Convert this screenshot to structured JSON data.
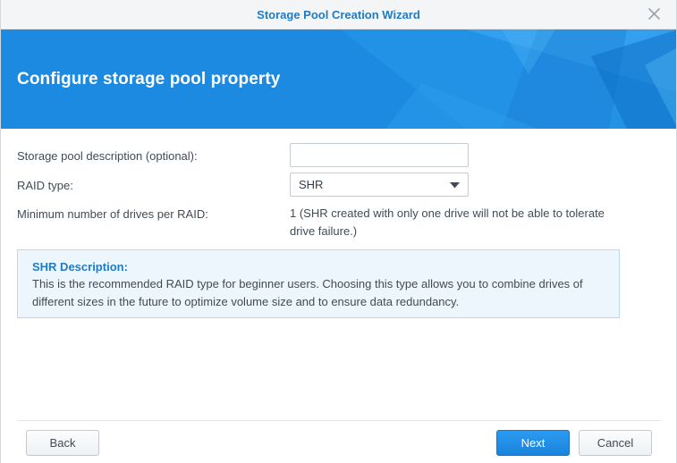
{
  "window": {
    "title": "Storage Pool Creation Wizard"
  },
  "banner": {
    "heading": "Configure storage pool property"
  },
  "form": {
    "description_label": "Storage pool description (optional):",
    "description_value": "",
    "raid_label": "RAID type:",
    "raid_value": "SHR",
    "min_drives_label": "Minimum number of drives per RAID:",
    "min_drives_value": "1 (SHR created with only one drive will not be able to tolerate drive failure.)"
  },
  "description_box": {
    "title": "SHR Description:",
    "text": "This is the recommended RAID type for beginner users. Choosing this type allows you to combine drives of different sizes in the future to optimize volume size and to ensure data redundancy."
  },
  "footer": {
    "back_label": "Back",
    "next_label": "Next",
    "cancel_label": "Cancel"
  },
  "colors": {
    "accent": "#1f7bc4",
    "banner": "#1b8ae0",
    "primary_button": "#1a84dc",
    "info_box_bg": "#eef6fd"
  },
  "icons": {
    "close": "close-icon",
    "dropdown": "chevron-down-icon"
  }
}
